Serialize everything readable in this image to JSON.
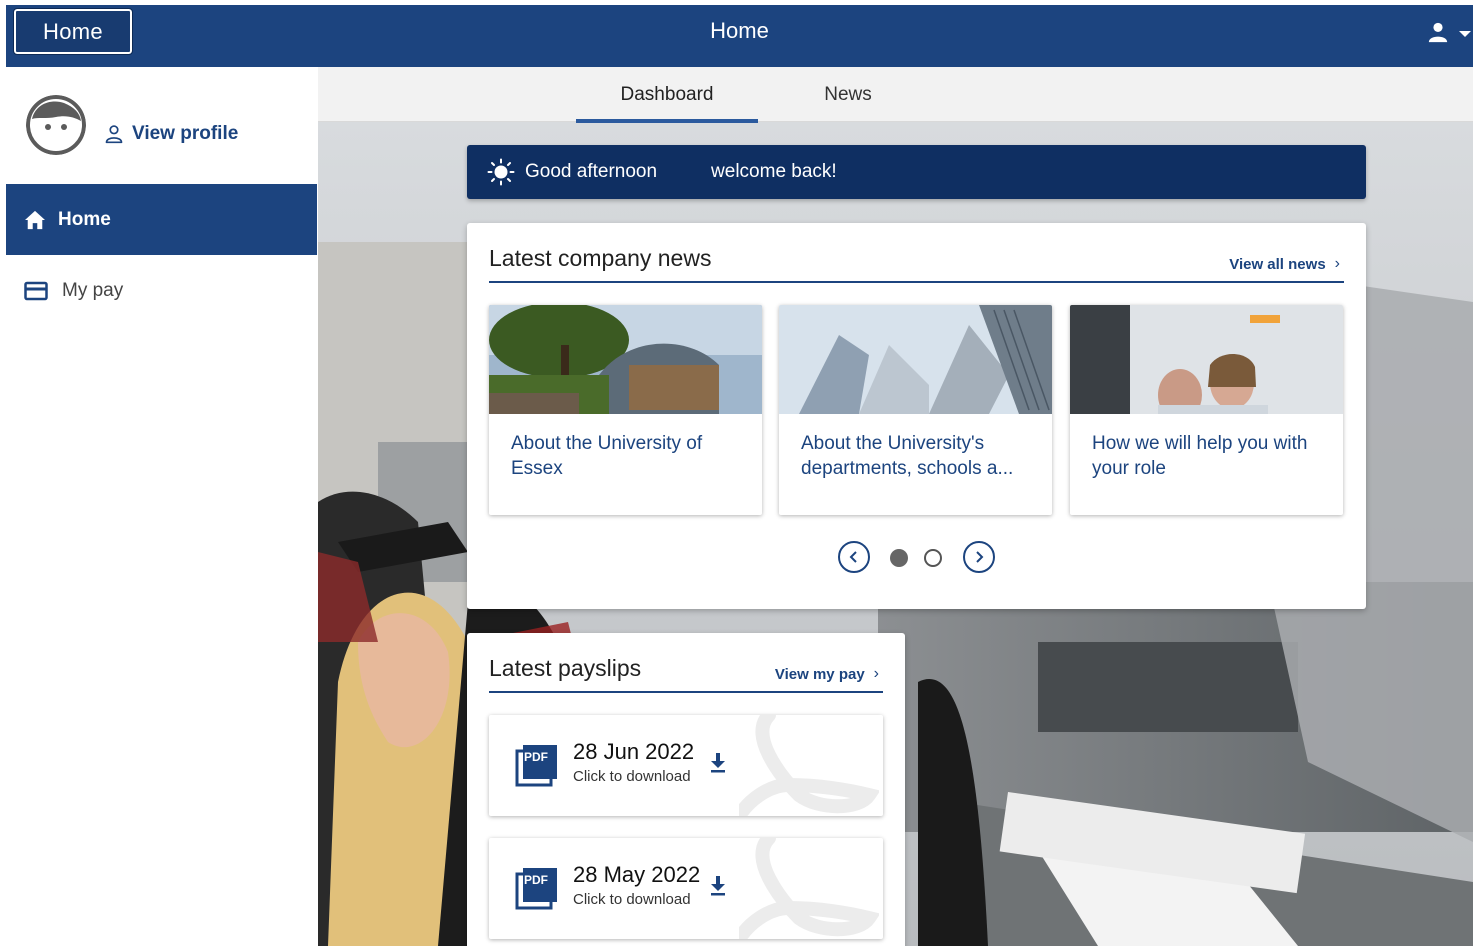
{
  "header": {
    "home_button": "Home",
    "title": "Home"
  },
  "sidebar": {
    "view_profile": "View profile",
    "items": [
      {
        "label": "Home",
        "active": true
      },
      {
        "label": "My pay",
        "active": false
      }
    ]
  },
  "tabs": [
    {
      "label": "Dashboard",
      "active": true
    },
    {
      "label": "News",
      "active": false
    }
  ],
  "greeting": {
    "text": "Good afternoon",
    "message": "welcome back!"
  },
  "news": {
    "title": "Latest company news",
    "view_all": "View all news",
    "items": [
      {
        "title": "About the University of Essex"
      },
      {
        "title": "About the University's departments, schools a..."
      },
      {
        "title": "How we will help you with your role"
      }
    ],
    "carousel": {
      "pages": 2,
      "current": 1
    }
  },
  "payslips": {
    "title": "Latest payslips",
    "view_link": "View my pay",
    "items": [
      {
        "date": "28 Jun 2022",
        "action": "Click to download",
        "badge": "PDF"
      },
      {
        "date": "28 May 2022",
        "action": "Click to download",
        "badge": "PDF"
      }
    ]
  },
  "colors": {
    "brand": "#1c447f",
    "brand_dark": "#0f2f62",
    "tab_bg": "#f2f2f2"
  }
}
